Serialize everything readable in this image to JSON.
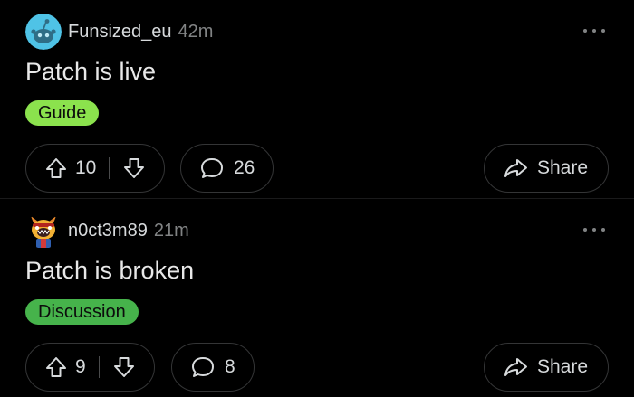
{
  "colors": {
    "background": "#000000",
    "text_primary": "#d7dadc",
    "text_secondary": "#818384",
    "pill_border": "#343536"
  },
  "posts": [
    {
      "author": "Funsized_eu",
      "time": "42m",
      "title": "Patch is live",
      "flair": {
        "label": "Guide",
        "color": "#8be24d"
      },
      "votes": "10",
      "comments": "26",
      "share_label": "Share",
      "icons": {
        "avatar": "reddit-snoo-avatar-icon",
        "more": "more-dots-icon",
        "upvote": "upvote-arrow-icon",
        "downvote": "downvote-arrow-icon",
        "comment": "comment-bubble-icon",
        "share": "share-arrow-icon"
      }
    },
    {
      "author": "n0ct3m89",
      "time": "21m",
      "title": "Patch is broken",
      "flair": {
        "label": "Discussion",
        "color": "#46b34b"
      },
      "votes": "9",
      "comments": "8",
      "share_label": "Share",
      "icons": {
        "avatar": "cartoon-character-avatar-icon",
        "more": "more-dots-icon",
        "upvote": "upvote-arrow-icon",
        "downvote": "downvote-arrow-icon",
        "comment": "comment-bubble-icon",
        "share": "share-arrow-icon"
      }
    }
  ]
}
